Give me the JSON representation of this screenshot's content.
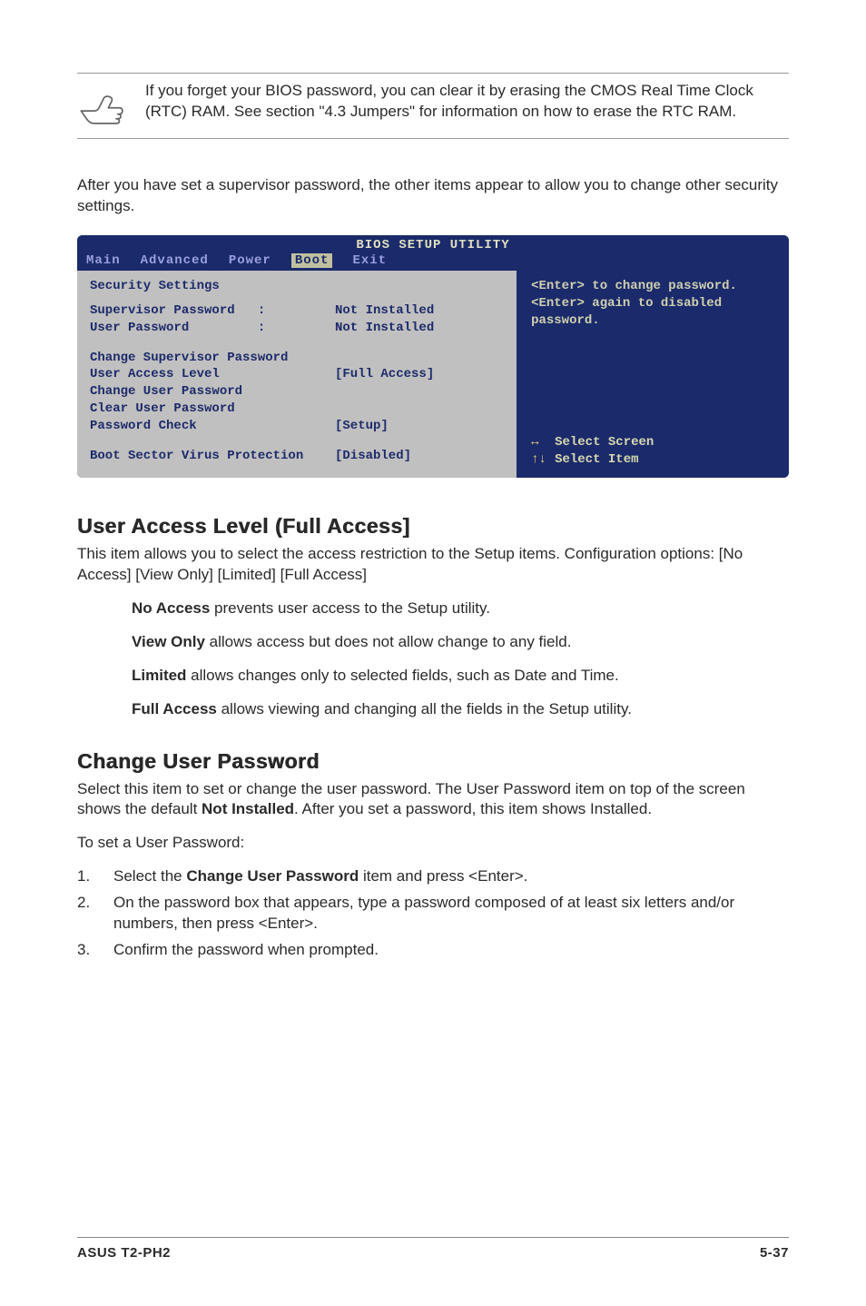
{
  "note": "If you forget your BIOS password, you can clear it by erasing the CMOS Real Time Clock (RTC) RAM. See section \"4.3 Jumpers\" for information on how to erase the RTC RAM.",
  "intro": "After you have set a supervisor password, the other items appear to allow you to change other security settings.",
  "bios": {
    "title": "BIOS SETUP UTILITY",
    "menu": {
      "main": "Main",
      "advanced": "Advanced",
      "power": "Power",
      "boot": "Boot",
      "exit": "Exit"
    },
    "security_title": "Security Settings",
    "supervisor_label": "Supervisor Password   :",
    "supervisor_val": "Not Installed",
    "user_label": "User Password         :",
    "user_val": "Not Installed",
    "change_sup": "Change Supervisor Password",
    "ual_label": "User Access Level",
    "ual_val": "[Full Access]",
    "change_user": "Change User Password",
    "clear_user": "Clear User Password",
    "pwcheck_label": "Password Check",
    "pwcheck_val": "[Setup]",
    "bsvp_label": "Boot Sector Virus Protection",
    "bsvp_val": "[Disabled]",
    "help1": "<Enter> to change password.",
    "help2": "<Enter> again to disabled password.",
    "nav1": "Select Screen",
    "nav2": "Select Item"
  },
  "sect1": {
    "heading": "User Access Level (Full Access]",
    "p1": "This item allows you to select the access restriction to the Setup items. Configuration options: [No Access] [View Only] [Limited] [Full Access]",
    "na_b": "No Access",
    "na_t": " prevents user access to the Setup utility.",
    "vo_b": "View Only",
    "vo_t": " allows access but does not allow change to any field.",
    "li_b": "Limited",
    "li_t": " allows changes only to selected fields, such as Date and Time.",
    "fa_b": "Full Access",
    "fa_t": " allows viewing and changing all the fields in the Setup utility."
  },
  "sect2": {
    "heading": "Change User Password",
    "p1a": "Select this item to set or change the user password. The User Password item on top of the screen shows the default ",
    "p1b": "Not Installed",
    "p1c": ". After you set a password, this item shows Installed.",
    "p2": "To set a User Password:",
    "s1a": "Select the ",
    "s1b": "Change User Password",
    "s1c": " item and press <Enter>.",
    "s2": "On the password box that appears, type a password composed of at least six letters and/or numbers, then press <Enter>.",
    "s3": "Confirm the password when prompted."
  },
  "footer": {
    "left": "ASUS T2-PH2",
    "right": "5-37"
  }
}
